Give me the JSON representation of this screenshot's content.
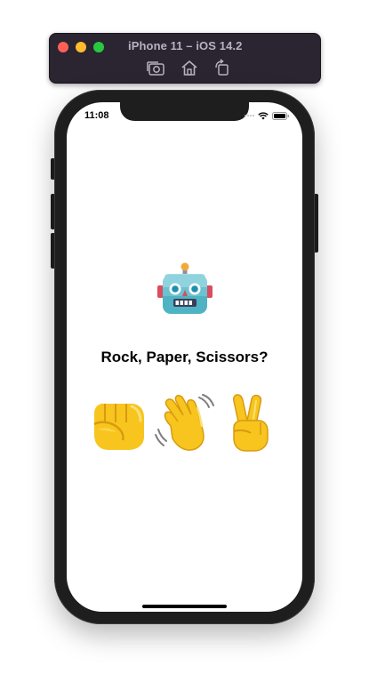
{
  "simulator": {
    "title": "iPhone 11 – iOS 14.2",
    "toolbar": {
      "screenshot_icon": "camera-icon",
      "home_icon": "home-icon",
      "rotate_icon": "rotate-icon"
    }
  },
  "status_bar": {
    "time": "11:08",
    "icons": [
      "signal-icon",
      "wifi-icon",
      "battery-icon"
    ]
  },
  "app": {
    "opponent_icon": "robot-emoji",
    "title": "Rock, Paper, Scissors?",
    "choices": [
      {
        "id": "rock",
        "icon": "raised-fist-emoji"
      },
      {
        "id": "paper",
        "icon": "waving-hand-emoji"
      },
      {
        "id": "scissors",
        "icon": "victory-hand-emoji"
      }
    ]
  },
  "colors": {
    "device_frame": "#1e1e1e",
    "toolbar_bg": "#2a2530",
    "close": "#ff5f57",
    "minimize": "#febc2e",
    "zoom": "#28c840",
    "hand_yellow": "#f7c51e",
    "robot_teal": "#4fb3c4"
  }
}
